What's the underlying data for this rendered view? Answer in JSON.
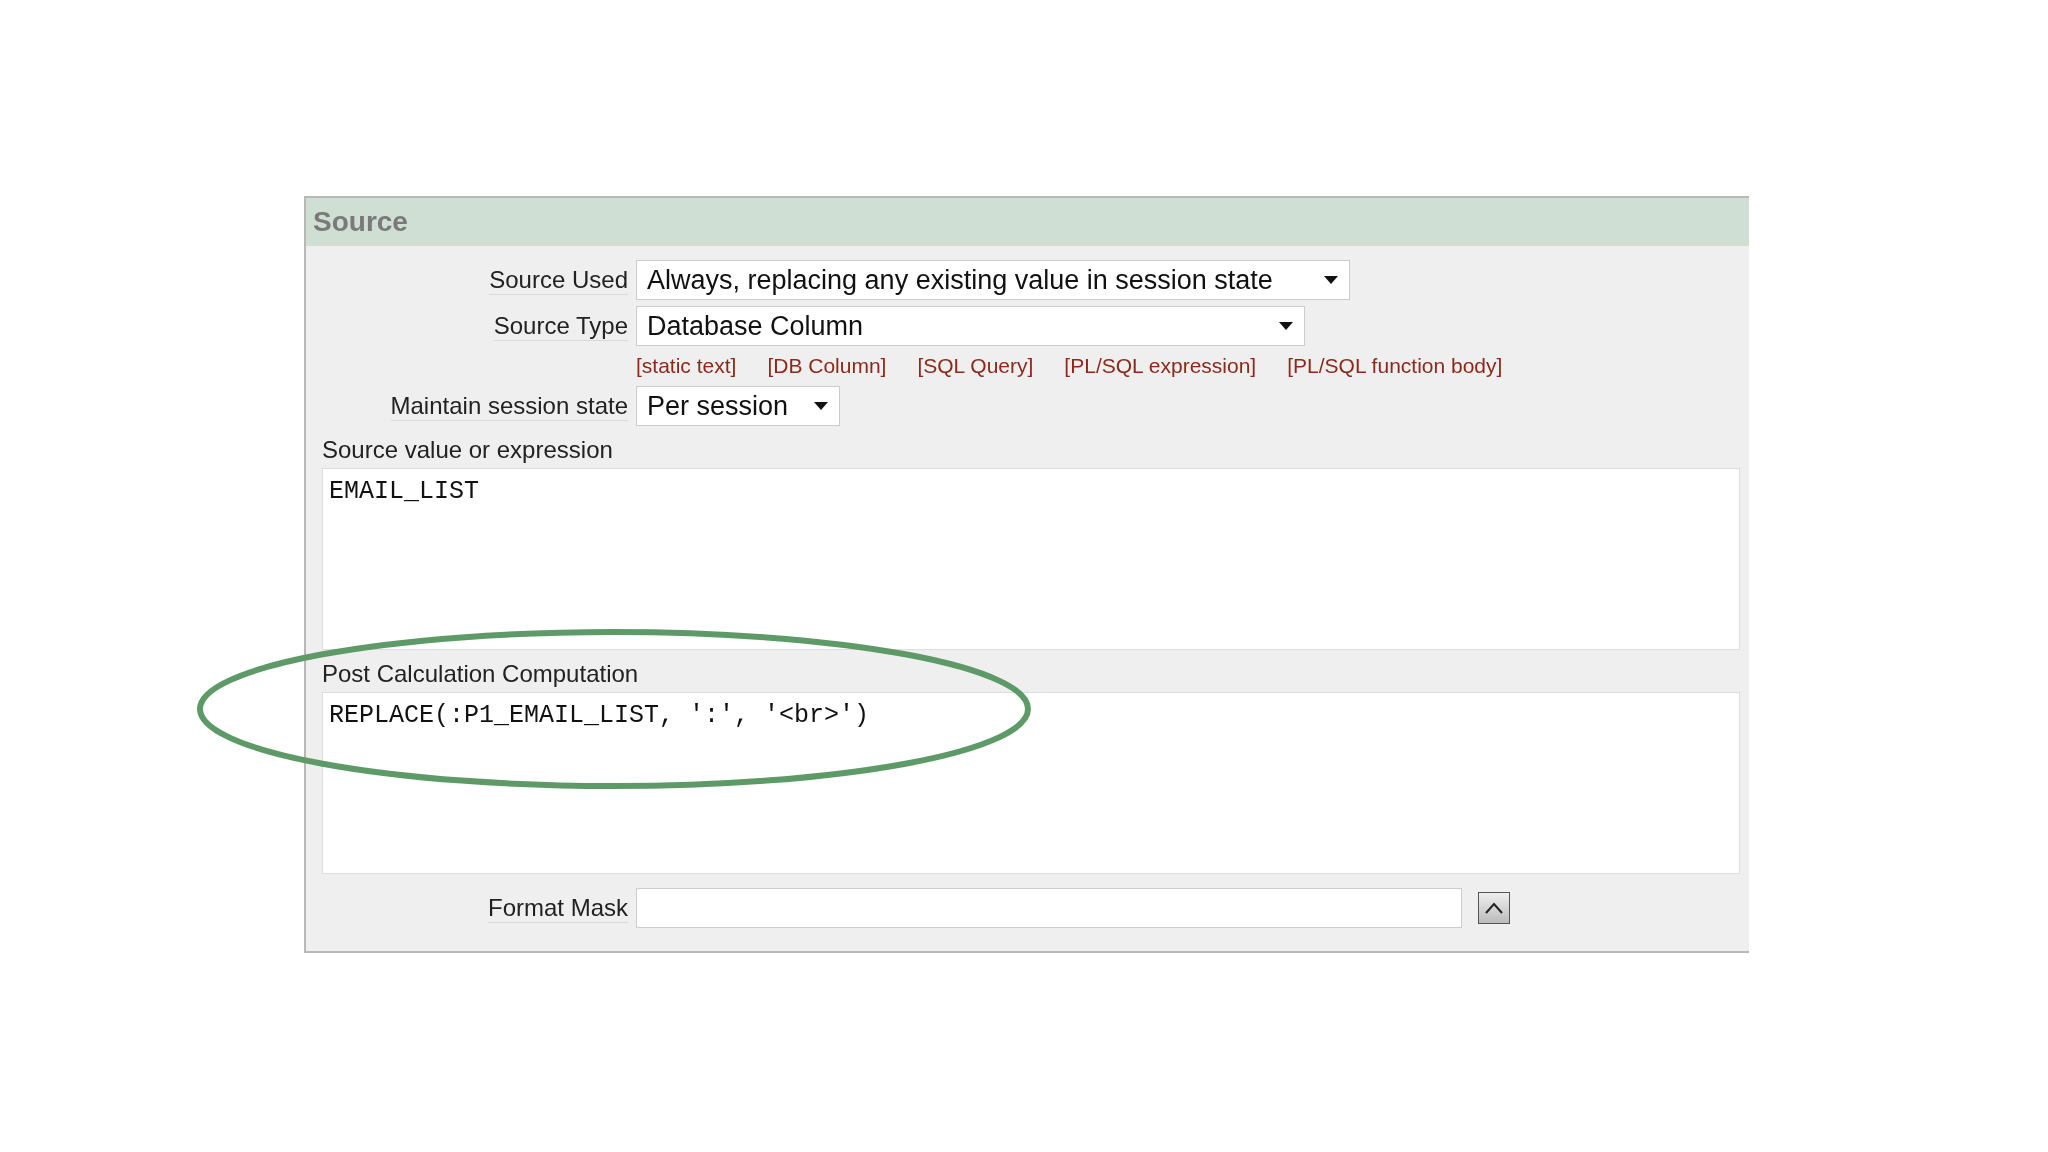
{
  "panel": {
    "title": "Source"
  },
  "rows": [
    {
      "kind": "select",
      "label": "Source Used",
      "value": "Always, replacing any existing value in session state"
    },
    {
      "kind": "select",
      "label": "Source Type",
      "value": "Database Column"
    },
    {
      "kind": "links",
      "links": [
        "[static text]",
        "[DB Column]",
        "[SQL Query]",
        "[PL/SQL expression]",
        "[PL/SQL function body]"
      ]
    },
    {
      "kind": "select",
      "label": "Maintain session state",
      "value": "Per session"
    },
    {
      "kind": "textarea",
      "label": "Source value or expression",
      "value": "EMAIL_LIST"
    },
    {
      "kind": "textarea",
      "label": "Post Calculation Computation",
      "value": "REPLACE(:P1_EMAIL_LIST, ':', '<br>')",
      "highlighted": true
    },
    {
      "kind": "input",
      "label": "Format Mask",
      "value": ""
    }
  ]
}
